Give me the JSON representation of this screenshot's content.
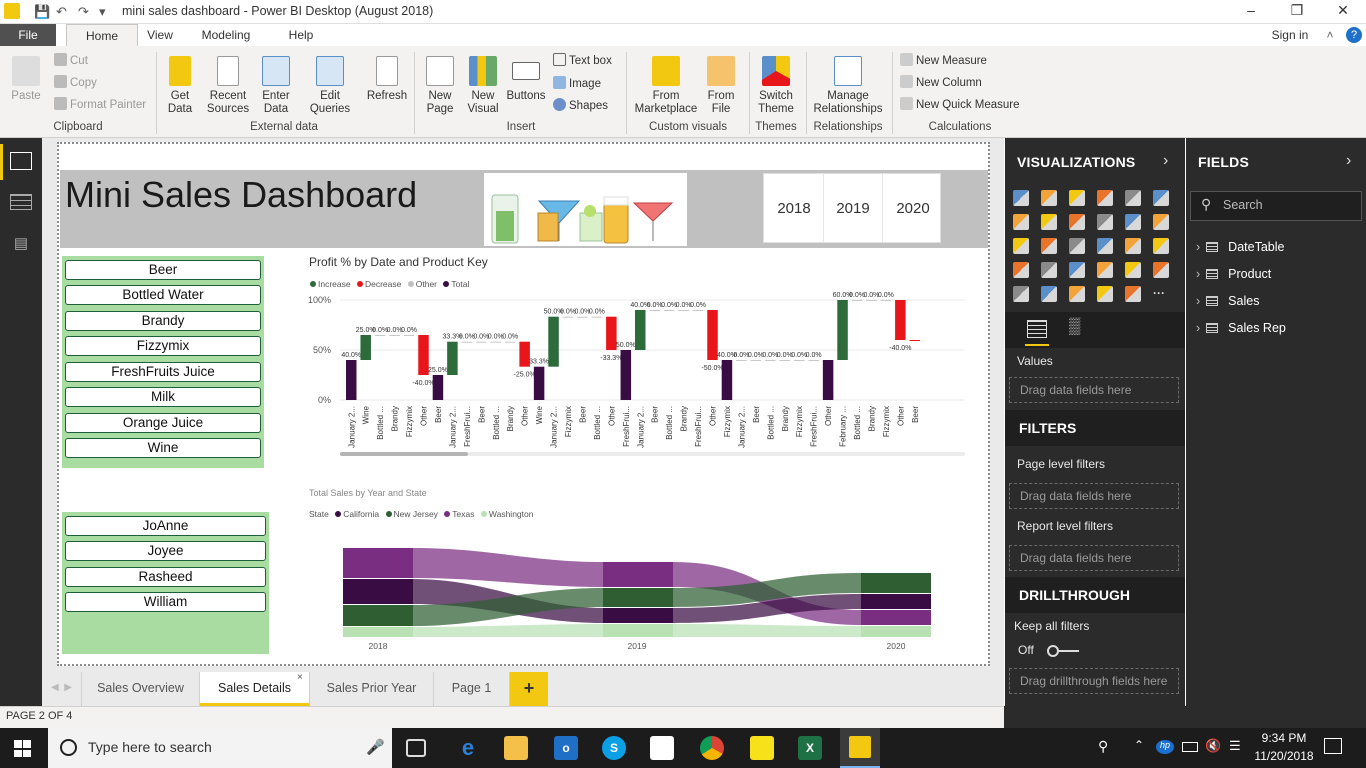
{
  "window": {
    "title": "mini sales dashboard - Power BI Desktop (August 2018)"
  },
  "ribbon_tabs": [
    "File",
    "Home",
    "View",
    "Modeling",
    "Help"
  ],
  "account": {
    "sign_in": "Sign in"
  },
  "ribbon": {
    "clipboard": {
      "paste": "Paste",
      "cut": "Cut",
      "copy": "Copy",
      "format_painter": "Format Painter",
      "group": "Clipboard"
    },
    "external": {
      "get_data": "Get Data",
      "recent": "Recent Sources",
      "enter": "Enter Data",
      "edit": "Edit Queries",
      "refresh": "Refresh",
      "group": "External data"
    },
    "insert": {
      "new_page": "New Page",
      "new_visual": "New Visual",
      "buttons": "Buttons",
      "text_box": "Text box",
      "image": "Image",
      "shapes": "Shapes",
      "group": "Insert"
    },
    "custom": {
      "marketplace": "From Marketplace",
      "file": "From File",
      "group": "Custom visuals"
    },
    "themes": {
      "switch": "Switch Theme",
      "group": "Themes"
    },
    "relationships": {
      "manage": "Manage Relationships",
      "group": "Relationships"
    },
    "calculations": {
      "measure": "New Measure",
      "column": "New Column",
      "quick": "New Quick Measure",
      "group": "Calculations"
    }
  },
  "dashboard": {
    "title": "Mini Sales Dashboard",
    "years": [
      "2018",
      "2019",
      "2020"
    ],
    "products": [
      "Beer",
      "Bottled Water",
      "Brandy",
      "Fizzymix",
      "FreshFruits Juice",
      "Milk",
      "Orange Juice",
      "Wine"
    ],
    "reps": [
      "JoAnne",
      "Joyee",
      "Rasheed",
      "William"
    ]
  },
  "chart_data": [
    {
      "type": "waterfall",
      "title": "Profit % by Date and Product Key",
      "legend": [
        "Increase",
        "Decrease",
        "Other",
        "Total"
      ],
      "colors": {
        "increase": "#2e6b3a",
        "decrease": "#e8161a",
        "total": "#3a0c44",
        "other": "#c0c0c0"
      },
      "y_ticks": [
        "100%",
        "50%",
        "0%"
      ],
      "ylim": [
        0,
        100
      ],
      "categories": [
        "January 2...",
        "Wine",
        "Bottled ...",
        "Brandy",
        "Fizzymix",
        "Other",
        "Beer",
        "January 2...",
        "FreshFrui...",
        "Beer",
        "Bottled ...",
        "Brandy",
        "Other",
        "Wine",
        "January 2...",
        "Fizzymix",
        "Beer",
        "Bottled ...",
        "Other",
        "FreshFrui...",
        "January 2...",
        "Beer",
        "Bottled ...",
        "Brandy",
        "FreshFrui...",
        "Other",
        "Fizzymix",
        "January 2...",
        "Beer",
        "Bottled ...",
        "Brandy",
        "Fizzymix",
        "FreshFrui...",
        "Other",
        "February ...",
        "Bottled ...",
        "Brandy",
        "Fizzymix",
        "Other",
        "Beer"
      ],
      "kinds": [
        "total",
        "inc",
        "inc",
        "inc",
        "inc",
        "dec",
        "total",
        "inc",
        "inc",
        "inc",
        "inc",
        "inc",
        "dec",
        "total",
        "inc",
        "inc",
        "inc",
        "inc",
        "dec",
        "total",
        "inc",
        "inc",
        "inc",
        "inc",
        "inc",
        "dec",
        "total",
        "inc",
        "inc",
        "inc",
        "inc",
        "inc",
        "inc",
        "total",
        "inc",
        "inc",
        "inc",
        "inc",
        "dec",
        "end"
      ],
      "values": [
        40.0,
        25.0,
        0.0,
        0.0,
        0.0,
        -40.0,
        25.0,
        33.3,
        0.0,
        0.0,
        0.0,
        0.0,
        -25.0,
        33.3,
        50.0,
        0.0,
        0.0,
        0.0,
        -33.3,
        50.0,
        40.0,
        0.0,
        0.0,
        0.0,
        0.0,
        -50.0,
        40.0,
        0.0,
        0.0,
        0.0,
        0.0,
        0.0,
        0.0,
        40.0,
        60.0,
        0.0,
        0.0,
        0.0,
        -40.0,
        0.0
      ],
      "labels": [
        "40.0%",
        "25.0%",
        "0.0%",
        "0.0%",
        "0.0%",
        "-40.0%",
        "25.0%",
        "33.3%",
        "0.0%",
        "0.0%",
        "0.0%",
        "0.0%",
        "-25.0%",
        "33.3%",
        "50.0%",
        "0.0%",
        "0.0%",
        "0.0%",
        "-33.3%",
        "50.0%",
        "40.0%",
        "0.0%",
        "0.0%",
        "0.0%",
        "0.0%",
        "-50.0%",
        "40.0%",
        "0.0%",
        "0.0%",
        "0.0%",
        "0.0%",
        "0.0%",
        "0.0%",
        "",
        "60.0%",
        "0.0%",
        "0.0%",
        "0.0%",
        "-40.0%",
        ""
      ]
    },
    {
      "type": "ribbon",
      "title": "Total Sales by Year and State",
      "legend_title": "State",
      "legend": [
        "California",
        "New Jersey",
        "Texas",
        "Washington"
      ],
      "colors": {
        "California": "#3a0c44",
        "New Jersey": "#2e5e32",
        "Texas": "#7a2e82",
        "Washington": "#b9e1b4"
      },
      "categories": [
        "2018",
        "2019",
        "2020"
      ]
    }
  ],
  "visualizations": {
    "title": "VISUALIZATIONS",
    "values": "Values",
    "drag": "Drag data fields here"
  },
  "filters": {
    "title": "FILTERS",
    "page": "Page level filters",
    "report": "Report level filters",
    "drag": "Drag data fields here"
  },
  "drillthrough": {
    "title": "DRILLTHROUGH",
    "keep": "Keep all filters",
    "off": "Off",
    "drag": "Drag drillthrough fields here"
  },
  "fields": {
    "title": "FIELDS",
    "search": "Search",
    "tables": [
      "DateTable",
      "Product",
      "Sales",
      "Sales Rep"
    ]
  },
  "pages": [
    "Sales Overview",
    "Sales Details",
    "Sales Prior Year",
    "Page 1"
  ],
  "status": {
    "page": "PAGE 2 OF 4"
  },
  "taskbar": {
    "search": "Type here to search",
    "time": "9:34 PM",
    "date": "11/20/2018"
  }
}
